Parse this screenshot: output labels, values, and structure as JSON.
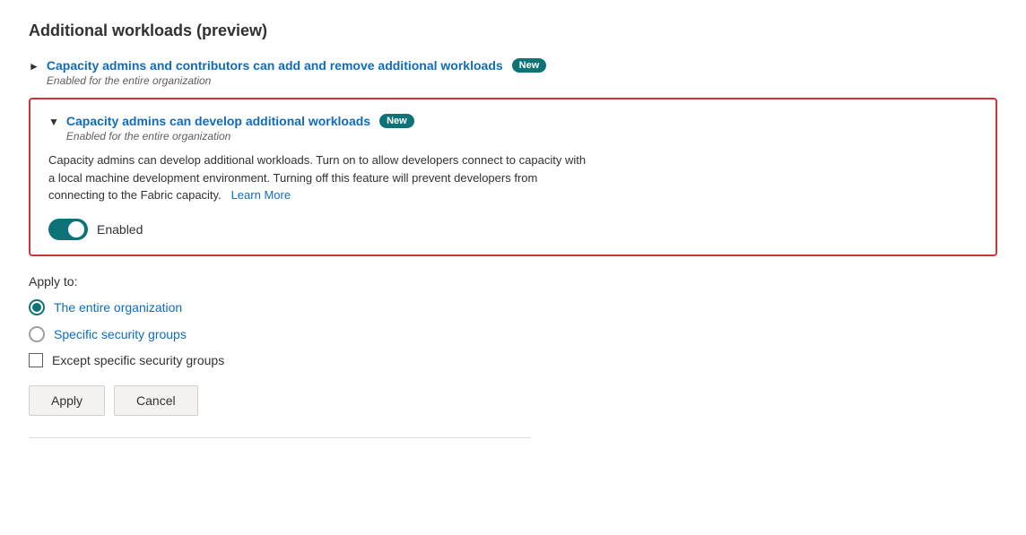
{
  "page": {
    "title": "Additional workloads (preview)"
  },
  "workload1": {
    "title": "Capacity admins and contributors can add and remove additional workloads",
    "badge": "New",
    "subtitle": "Enabled for the entire organization"
  },
  "workload2": {
    "title": "Capacity admins can develop additional workloads",
    "badge": "New",
    "subtitle": "Enabled for the entire organization",
    "description1": "Capacity admins can develop additional workloads. Turn on to allow developers connect to capacity with a local machine development environment. Turning off this feature will prevent developers from connecting to the Fabric capacity.",
    "learn_more_label": "Learn More",
    "toggle_label": "Enabled"
  },
  "apply_to": {
    "label": "Apply to:",
    "options": [
      {
        "label": "The entire organization",
        "selected": true
      },
      {
        "label": "Specific security groups",
        "selected": false
      }
    ],
    "checkbox_label": "Except specific security groups"
  },
  "buttons": {
    "apply_label": "Apply",
    "cancel_label": "Cancel"
  }
}
